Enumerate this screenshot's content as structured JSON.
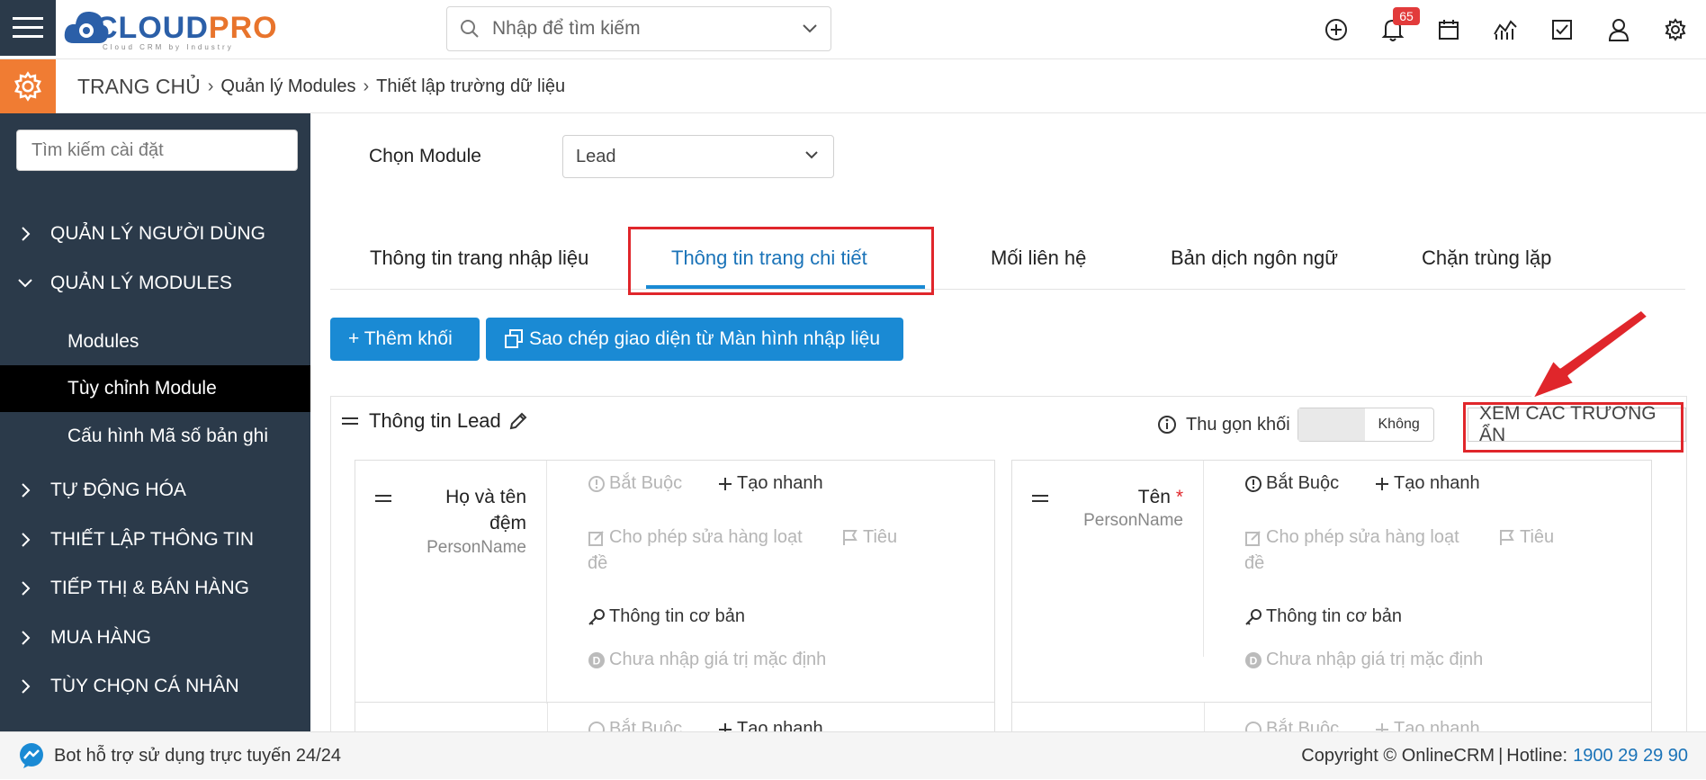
{
  "header": {
    "logo_cloud": "CLOUD",
    "logo_pro": "PRO",
    "logo_tagline": "Cloud CRM by Industry",
    "search_placeholder": "Nhập để tìm kiếm",
    "notification_count": "65",
    "icons": [
      "plus-circle-icon",
      "bell-icon",
      "calendar-icon",
      "chart-icon",
      "checkbox-icon",
      "user-icon",
      "gear-icon"
    ]
  },
  "breadcrumb": {
    "home": "TRANG CHỦ",
    "level1": "Quản lý Modules",
    "level2": "Thiết lập trường dữ liệu"
  },
  "sidebar": {
    "search_placeholder": "Tìm kiếm cài đặt",
    "items": [
      {
        "label": "QUẢN LÝ NGƯỜI DÙNG",
        "expanded": false
      },
      {
        "label": "QUẢN LÝ MODULES",
        "expanded": true
      },
      {
        "label": "TỰ ĐỘNG HÓA",
        "expanded": false
      },
      {
        "label": "THIẾT LẬP THÔNG TIN",
        "expanded": false
      },
      {
        "label": "TIẾP THỊ & BÁN HÀNG",
        "expanded": false
      },
      {
        "label": "MUA HÀNG",
        "expanded": false
      },
      {
        "label": "TÙY CHỌN CÁ NHÂN",
        "expanded": false
      }
    ],
    "subitems": [
      {
        "label": "Modules",
        "active": false
      },
      {
        "label": "Tùy chỉnh Module",
        "active": true
      },
      {
        "label": "Cấu hình Mã số bản ghi",
        "active": false
      }
    ]
  },
  "main": {
    "module_label": "Chọn Module",
    "module_value": "Lead",
    "tabs": [
      {
        "label": "Thông tin trang nhập liệu",
        "active": false
      },
      {
        "label": "Thông tin trang chi tiết",
        "active": true
      },
      {
        "label": "Mối liên hệ",
        "active": false
      },
      {
        "label": "Bản dịch ngôn ngữ",
        "active": false
      },
      {
        "label": "Chặn trùng lặp",
        "active": false
      }
    ],
    "add_block_label": "+ Thêm khối",
    "copy_layout_label": "Sao chép giao diện từ Màn hình nhập liệu",
    "block": {
      "title": "Thông tin Lead",
      "collapse_label": "Thu gọn khối",
      "toggle_value": "Không",
      "show_hidden_label": "XEM CÁC TRƯỜNG ẨN",
      "fields": [
        {
          "name_line1": "Họ và tên",
          "name_line2": "đệm",
          "required_mark": "",
          "type": "PersonName",
          "required_label": "Bắt Buộc",
          "quick_create_label": "Tạo nhanh",
          "mass_edit_label": "Cho phép sửa hàng loạt",
          "header_label_a": "Tiêu",
          "header_label_b": "đề",
          "basic_info_label": "Thông tin cơ bản",
          "default_value_label": "Chưa nhập giá trị mặc định"
        },
        {
          "name_line1": "Tên",
          "name_line2": "",
          "required_mark": "*",
          "type": "PersonName",
          "required_label": "Bắt Buộc",
          "quick_create_label": "Tạo nhanh",
          "mass_edit_label": "Cho phép sửa hàng loạt",
          "header_label_a": "Tiêu",
          "header_label_b": "đề",
          "basic_info_label": "Thông tin cơ bản",
          "default_value_label": "Chưa nhập giá trị mặc định"
        }
      ],
      "partial_row_labels": {
        "required": "Bắt Buộc",
        "quick_create": "Tạo nhanh"
      }
    }
  },
  "footer": {
    "bot_label": "Bot hỗ trợ sử dụng trực tuyến 24/24",
    "copyright": "Copyright © OnlineCRM",
    "hotline_label": "Hotline:",
    "hotline_number": "1900 29 29 90"
  },
  "colors": {
    "sidebar_bg": "#2b3a4a",
    "accent_orange": "#f07c33",
    "primary_blue": "#1a8ad4",
    "annotation_red": "#e0262b"
  }
}
